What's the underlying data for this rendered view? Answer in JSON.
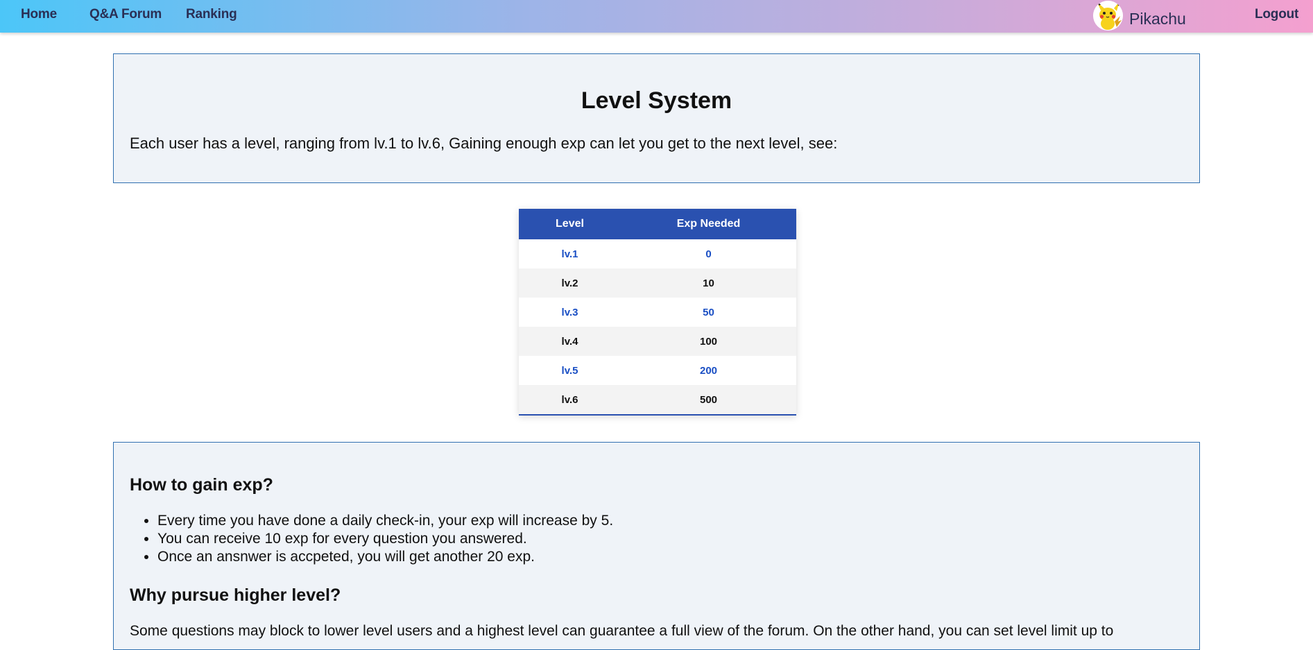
{
  "nav": {
    "home": "Home",
    "forum": "Q&A Forum",
    "ranking": "Ranking",
    "username": "Pikachu",
    "logout": "Logout"
  },
  "intro_panel": {
    "title": "Level System",
    "text": "Each user has a level, ranging from lv.1 to lv.6, Gaining enough exp can let you get to the next level, see:"
  },
  "level_table": {
    "headers": [
      "Level",
      "Exp Needed"
    ],
    "rows": [
      [
        "lv.1",
        "0"
      ],
      [
        "lv.2",
        "10"
      ],
      [
        "lv.3",
        "50"
      ],
      [
        "lv.4",
        "100"
      ],
      [
        "lv.5",
        "200"
      ],
      [
        "lv.6",
        "500"
      ]
    ]
  },
  "info_panel": {
    "gain_heading": "How to gain exp?",
    "gain_items": [
      "Every time you have done a daily check-in, your exp will increase by 5.",
      "You can receive 10 exp for every question you answered.",
      "Once an ansnwer is accpeted, you will get another 20 exp."
    ],
    "why_heading": "Why pursue higher level?",
    "why_text": "Some questions may block to lower level users and a highest level can guarantee a full view of the forum. On the other hand, you can set level limit up to"
  },
  "colors": {
    "accent": "#2a51b0",
    "panel_border": "#2f6fb0",
    "panel_bg": "#eff3f8",
    "link_blue": "#1a4fc4"
  },
  "icons": {
    "avatar": "pikachu-avatar"
  }
}
